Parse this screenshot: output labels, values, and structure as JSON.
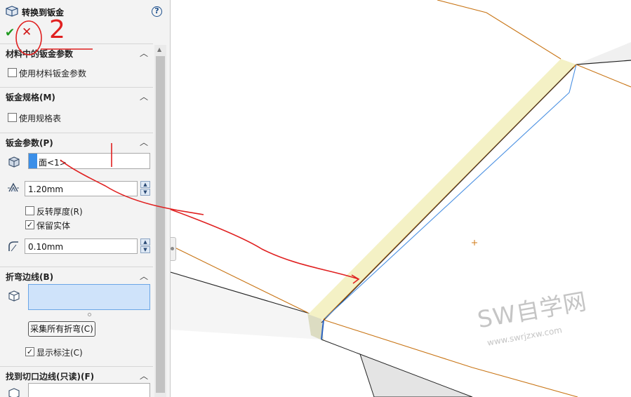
{
  "panel": {
    "title": "转换到钣金",
    "help": "?",
    "ok": "✔",
    "cancel": "✕",
    "sections": {
      "material": {
        "label": "材料中的钣金参数",
        "checkbox_label": "使用材料钣金参数",
        "checked": false
      },
      "gauge": {
        "label": "钣金规格(M)",
        "checkbox_label": "使用规格表",
        "checked": false
      },
      "params": {
        "label": "钣金参数(P)",
        "face_value": "面<1>",
        "thickness": "1.20mm",
        "reverse_label": "反转厚度(R)",
        "keep_body_label": "保留实体",
        "radius": "0.10mm"
      },
      "bend_edges": {
        "label": "折弯边线(B)",
        "collect_button": "采集所有折弯(C)",
        "show_callouts_label": "显示标注(C)"
      },
      "rip_edges": {
        "label": "找到切口边线(只读)(F)"
      }
    }
  },
  "annotations": {
    "number": "2"
  },
  "watermark": {
    "title": "SW自学网",
    "url": "www.swrjzxw.com"
  },
  "colors": {
    "accent": "#3b8fe8",
    "edge_orange": "#d07a16",
    "highlight": "#f3f0c6",
    "annotation_red": "#e02020"
  }
}
